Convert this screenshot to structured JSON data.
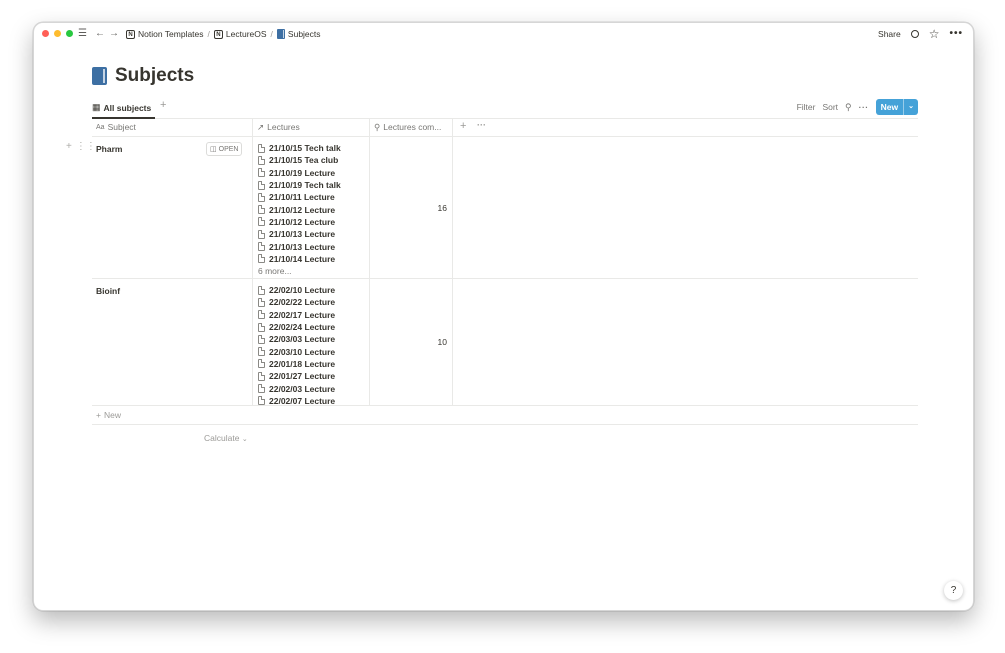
{
  "titlebar": {
    "traffic_colors": [
      "#ff5f57",
      "#febc2e",
      "#28c840"
    ],
    "menu_icon": "hamburger-icon",
    "back_icon": "arrow-left-icon",
    "forward_icon": "arrow-right-icon",
    "breadcrumbs": [
      {
        "label": "Notion Templates",
        "icon": "notion-icon"
      },
      {
        "label": "LectureOS",
        "icon": "notion-icon"
      },
      {
        "label": "Subjects",
        "icon": "book-icon"
      }
    ],
    "share_label": "Share"
  },
  "page": {
    "title": "Subjects",
    "icon": "book-icon"
  },
  "view": {
    "tab_label": "All subjects",
    "filter_label": "Filter",
    "sort_label": "Sort",
    "new_label": "New"
  },
  "table": {
    "columns": [
      {
        "label": "Subject",
        "icon": "text-icon"
      },
      {
        "label": "Lectures",
        "icon": "relation-arrow-icon"
      },
      {
        "label": "Lectures com...",
        "icon": "search-icon"
      }
    ],
    "open_label": "OPEN",
    "rows": [
      {
        "subject": "Pharm",
        "lectures": [
          "21/10/15 Tech talk",
          "21/10/15 Tea club",
          "21/10/19 Lecture",
          "21/10/19 Tech talk",
          "21/10/11 Lecture",
          "21/10/12 Lecture",
          "21/10/12 Lecture",
          "21/10/13 Lecture",
          "21/10/13 Lecture",
          "21/10/14 Lecture"
        ],
        "more": "6 more...",
        "count": "16"
      },
      {
        "subject": "Bioinf",
        "lectures": [
          "22/02/10 Lecture",
          "22/02/22 Lecture",
          "22/02/17 Lecture",
          "22/02/24 Lecture",
          "22/03/03 Lecture",
          "22/03/10 Lecture",
          "22/01/18 Lecture",
          "22/01/27 Lecture",
          "22/02/03 Lecture",
          "22/02/07 Lecture"
        ],
        "more": "",
        "count": "10"
      }
    ],
    "new_row_label": "New",
    "calculate_label": "Calculate"
  },
  "help_label": "?"
}
